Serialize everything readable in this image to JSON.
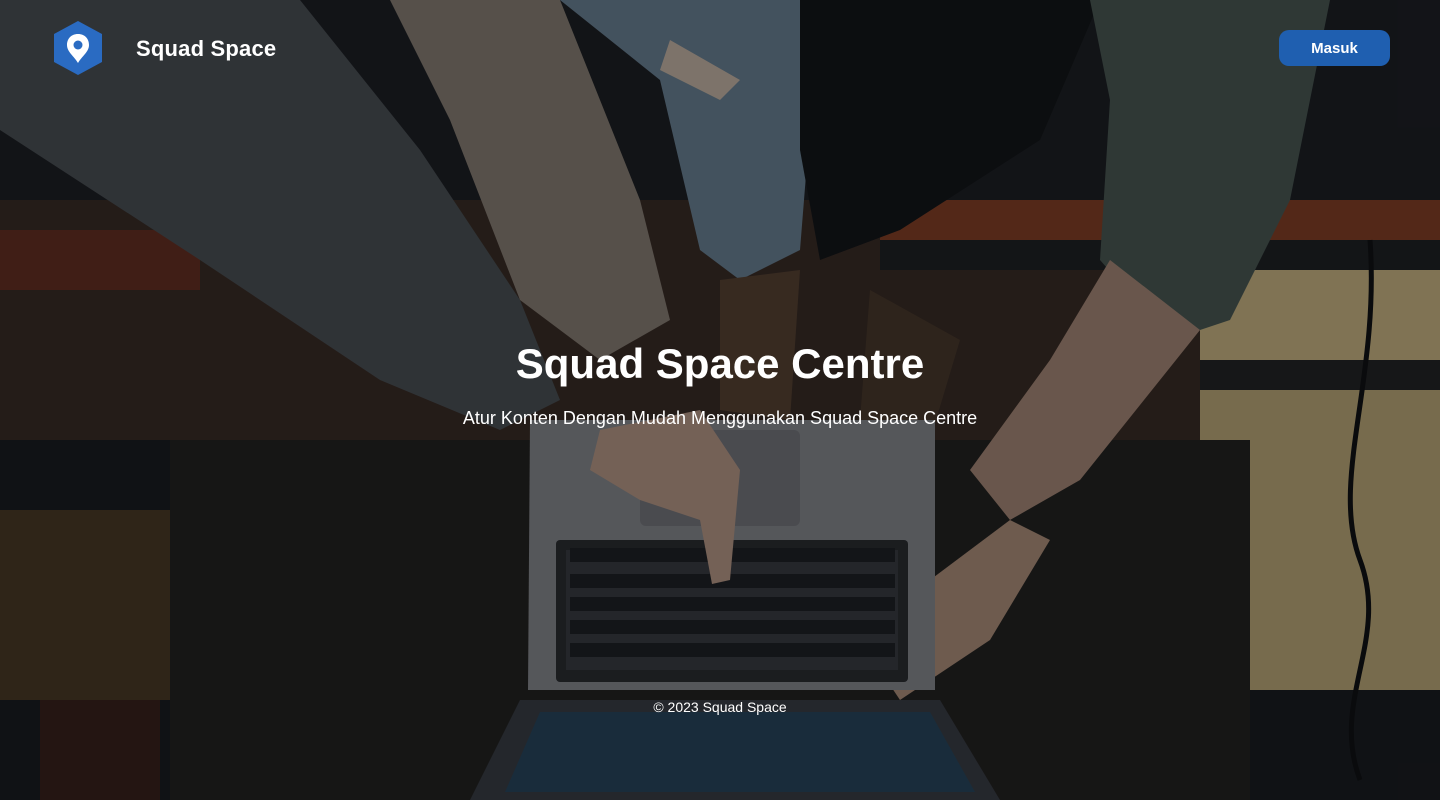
{
  "header": {
    "brand_name": "Squad Space",
    "login_label": "Masuk",
    "logo_icon": "map-pin-hexagon-icon"
  },
  "hero": {
    "title": "Squad Space Centre",
    "subtitle": "Atur Konten Dengan Mudah Menggunakan Squad Space Centre"
  },
  "footer": {
    "copyright": "© 2023 Squad Space"
  },
  "colors": {
    "accent": "#1f5fb0",
    "logo": "#2a6bc2",
    "text": "#ffffff",
    "overlay": "rgba(8, 9, 12, 0.42)"
  }
}
